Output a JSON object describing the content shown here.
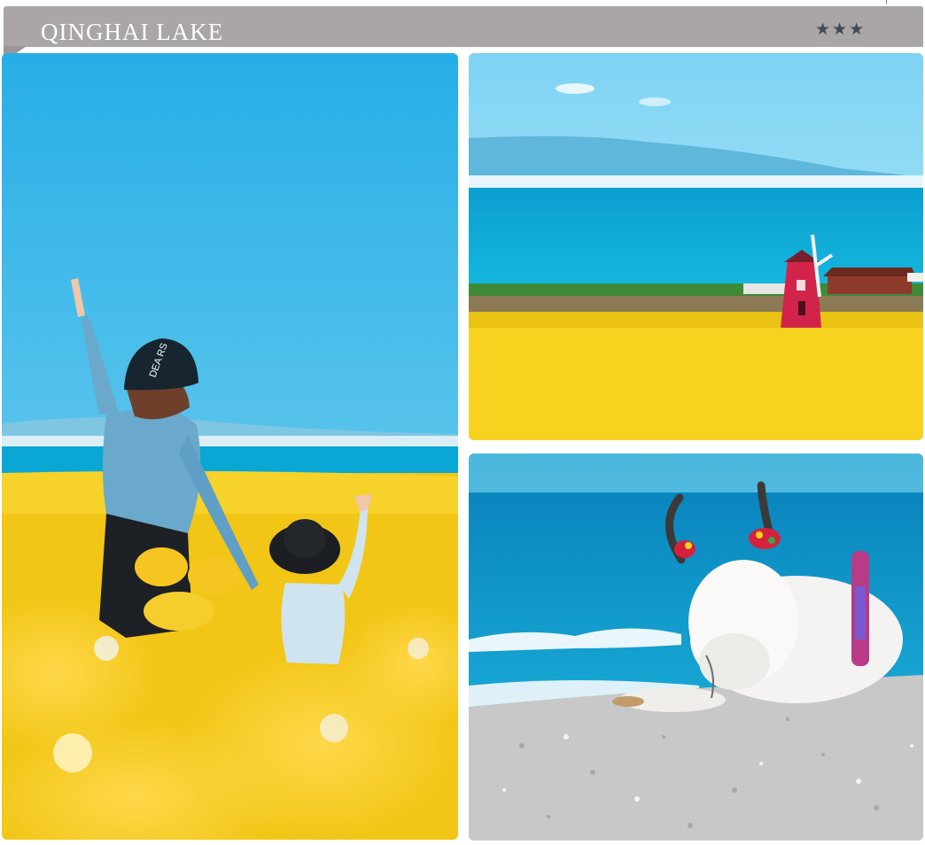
{
  "header": {
    "title": "QINGHAI LAKE",
    "stars": "★★★"
  },
  "photos": [
    {
      "id": "left",
      "subject": "woman and child waving in rapeseed field by the lake",
      "hat_text": "DEA RS"
    },
    {
      "id": "top-right",
      "subject": "red windmill in yellow rapeseed field with blue lake"
    },
    {
      "id": "bottom-right",
      "subject": "white yak with red flower garland resting on pebble shore"
    }
  ],
  "colors": {
    "ribbon": "#aaa6a7",
    "sky": "#3cb6e6",
    "lake": "#0aa2cf",
    "flowers": "#f5cf1a",
    "windmill": "#d2244a"
  }
}
